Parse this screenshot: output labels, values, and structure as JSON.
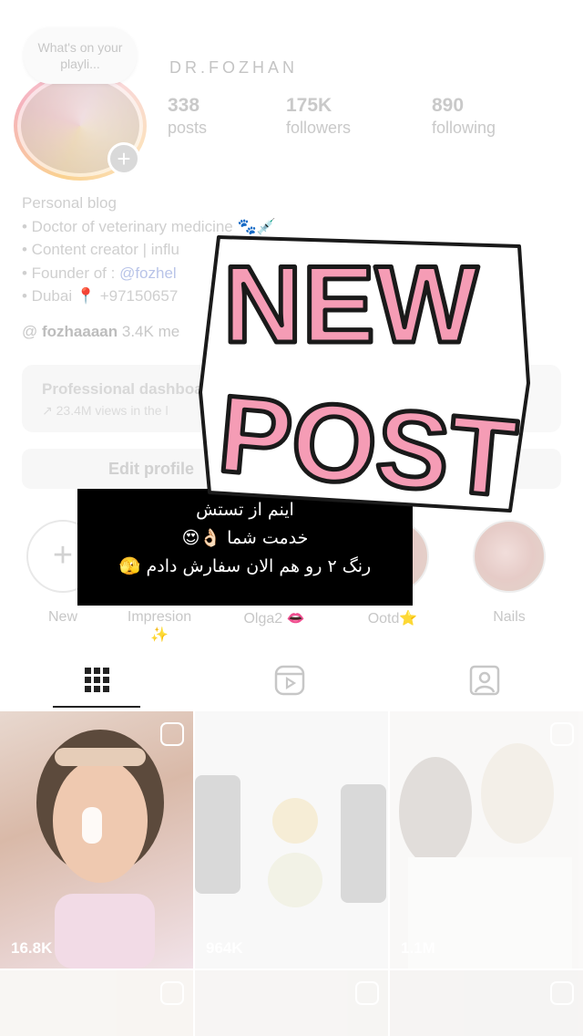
{
  "profile": {
    "note": "What's on your playli...",
    "username": "DR.FOZHAN",
    "stats": [
      {
        "num": "338",
        "label": "posts"
      },
      {
        "num": "175K",
        "label": "followers"
      },
      {
        "num": "890",
        "label": "following"
      }
    ],
    "bio": {
      "category": "Personal blog",
      "line1": "• Doctor of veterinary medicine 🐾💉",
      "line2": "• Content creator | influ",
      "line3_prefix": "• Founder of : ",
      "line3_link": "@fozhel",
      "line4": "• Dubai 📍 +97150657"
    },
    "threads_handle": "fozhaaaan",
    "threads_suffix": "3.4K me",
    "dashboard_title": "Professional dashboa",
    "dashboard_sub": "↗ 23.4M views in the l",
    "edit_profile": "Edit profile"
  },
  "highlights": [
    {
      "label": "New"
    },
    {
      "label": "Impresion ✨"
    },
    {
      "label": "Olga2 👄"
    },
    {
      "label": "Ootd⭐️"
    },
    {
      "label": "Nails"
    }
  ],
  "tabs": [
    {
      "icon": "grid-icon"
    },
    {
      "icon": "reels-icon"
    },
    {
      "icon": "tagged-icon"
    }
  ],
  "grid": [
    {
      "count": "16.8K"
    },
    {
      "count": "964K"
    },
    {
      "count": "1.1M"
    }
  ],
  "caption": {
    "line1": "اینم از تستش",
    "line2": "خدمت شما 👌🏻😍",
    "line3": "رنگ ۲ رو هم الان سفارش دادم 🫣"
  },
  "sticker": {
    "line1": "NEW",
    "line2": "POST"
  },
  "colors": {
    "sticker_pink": "#f59cb5",
    "sticker_outline": "#1a1a1a"
  }
}
